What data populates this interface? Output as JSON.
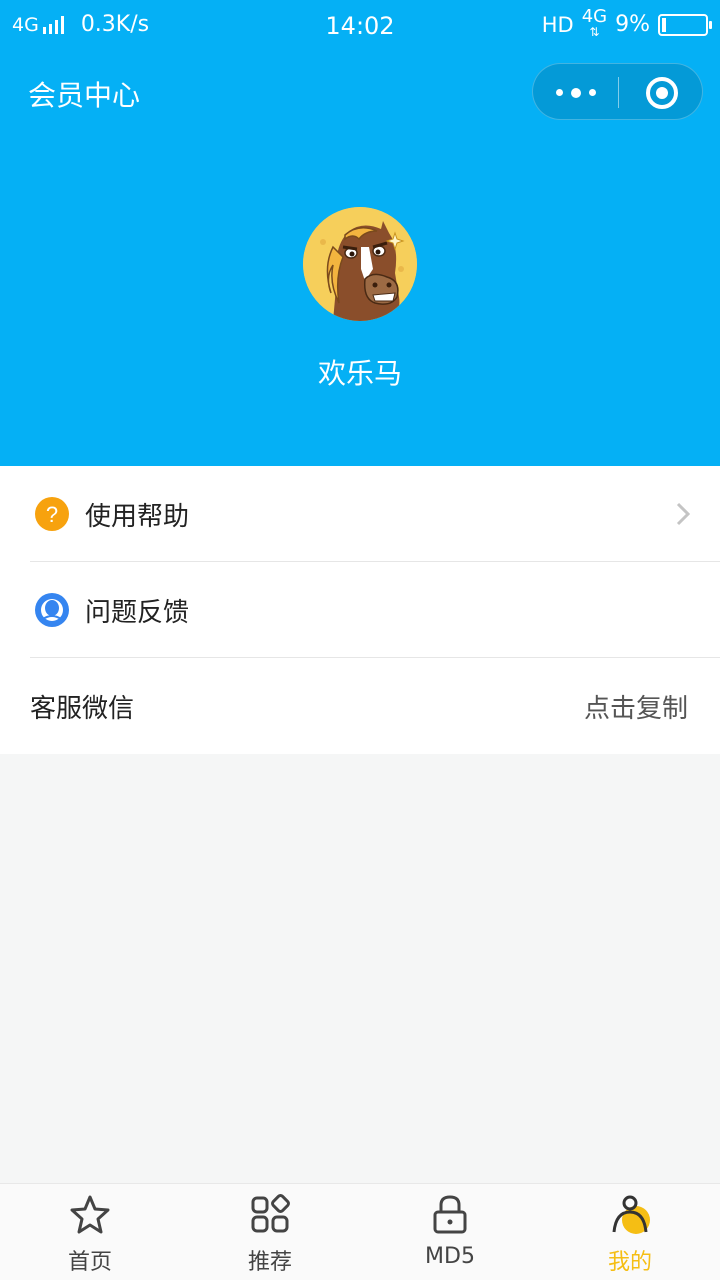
{
  "status_bar": {
    "network_left": "4G",
    "speed": "0.3K/s",
    "time": "14:02",
    "hd": "HD",
    "network_right": "4G",
    "battery": "9%"
  },
  "nav": {
    "title": "会员中心",
    "more_icon": "more-dots-icon",
    "close_icon": "target-circle-icon"
  },
  "profile": {
    "avatar_icon": "horse-avatar",
    "name": "欢乐马"
  },
  "menu": {
    "help": {
      "label": "使用帮助",
      "icon": "question-circle-icon",
      "icon_color": "#f7a20e"
    },
    "feedback": {
      "label": "问题反馈",
      "icon": "user-circle-icon",
      "icon_color": "#3585f0"
    },
    "wechat": {
      "label": "客服微信",
      "value": "点击复制"
    }
  },
  "tabbar": {
    "active_color": "#f5be14",
    "items": [
      {
        "label": "首页",
        "icon": "star-icon"
      },
      {
        "label": "推荐",
        "icon": "grid-icon"
      },
      {
        "label": "MD5",
        "icon": "lock-icon"
      },
      {
        "label": "我的",
        "icon": "user-icon"
      }
    ]
  },
  "colors": {
    "header_bg": "#05b0f5",
    "page_bg": "#f5f6f6"
  }
}
